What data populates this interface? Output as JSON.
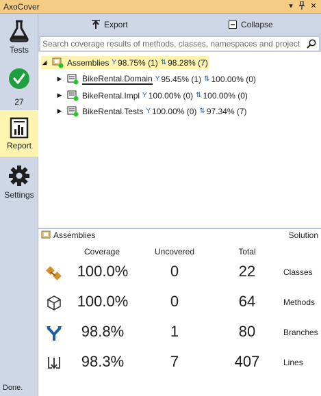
{
  "window": {
    "title": "AxoCover",
    "buttons": [
      "▾",
      "ᚆ",
      "✕"
    ]
  },
  "sidebar": {
    "items": [
      {
        "label": "Tests",
        "icon": "flask-icon"
      },
      {
        "label": "27",
        "icon": "check-circle-icon"
      },
      {
        "label": "Report",
        "icon": "report-icon"
      },
      {
        "label": "Settings",
        "icon": "gear-icon"
      }
    ],
    "active": "Report"
  },
  "status": "Done.",
  "toolbar": {
    "export_label": "Export",
    "collapse_label": "Collapse"
  },
  "search": {
    "placeholder": "Search coverage results of methods, classes, namespaces and projects",
    "value": ""
  },
  "tree": {
    "root": {
      "name": "Assemblies",
      "branch": "98.75% (1)",
      "line": "98.28% (7)"
    },
    "children": [
      {
        "name": "BikeRental.Domain",
        "branch": "95.45% (1)",
        "line": "100.00% (0)"
      },
      {
        "name": "BikeRental.Impl",
        "branch": "100.00% (0)",
        "line": "100.00% (0)"
      },
      {
        "name": "BikeRental.Tests",
        "branch": "100.00% (0)",
        "line": "97.34% (7)"
      }
    ]
  },
  "summary": {
    "title": "Assemblies",
    "scope": "Solution",
    "columns": [
      "Coverage",
      "Uncovered",
      "Total"
    ],
    "rows": [
      {
        "label": "Classes",
        "icon": "classes-icon",
        "coverage": "100.0%",
        "uncovered": "0",
        "total": "22"
      },
      {
        "label": "Methods",
        "icon": "methods-icon",
        "coverage": "100.0%",
        "uncovered": "0",
        "total": "64"
      },
      {
        "label": "Branches",
        "icon": "branches-icon",
        "coverage": "98.8%",
        "uncovered": "1",
        "total": "80"
      },
      {
        "label": "Lines",
        "icon": "lines-icon",
        "coverage": "98.3%",
        "uncovered": "7",
        "total": "407"
      }
    ]
  },
  "colors": {
    "titlebar": "#f5cc84",
    "sidebar": "#cfd6e5",
    "active_item": "#fdf4b0",
    "success_green": "#1e9e3d",
    "accent_blue": "#1e5da5"
  }
}
